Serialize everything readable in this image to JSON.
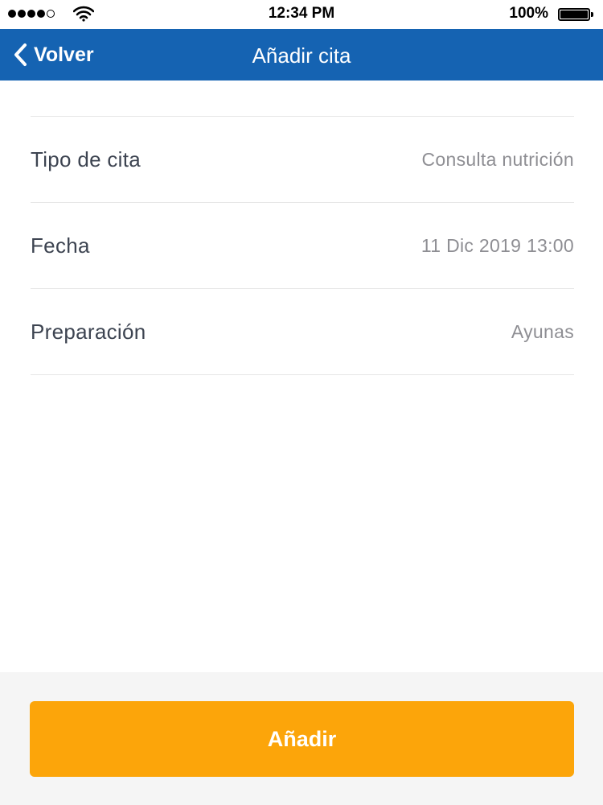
{
  "status_bar": {
    "time": "12:34 PM",
    "battery_pct": "100%",
    "signal_icon": "cellular-signal-icon",
    "wifi_icon": "wifi-icon",
    "battery_icon": "battery-icon",
    "battery_level": 1.0
  },
  "nav": {
    "back_label": "Volver",
    "back_icon": "chevron-left-icon",
    "title": "Añadir cita",
    "background_color": "#1563b2"
  },
  "form": {
    "rows": [
      {
        "label": "Tipo de cita",
        "value": "Consulta nutrición"
      },
      {
        "label": "Fecha",
        "value": "11 Dic 2019 13:00"
      },
      {
        "label": "Preparación",
        "value": "Ayunas"
      }
    ]
  },
  "footer": {
    "add_label": "Añadir",
    "button_color": "#fca50a"
  }
}
